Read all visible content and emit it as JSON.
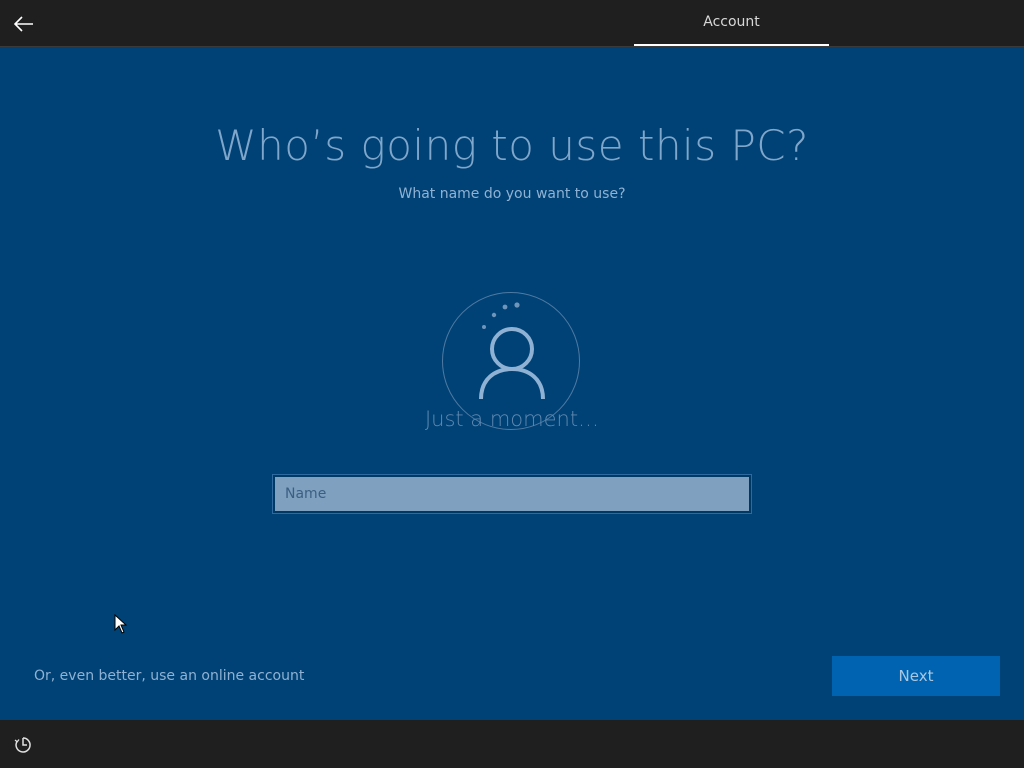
{
  "header": {
    "back_icon": "back-arrow-icon",
    "tab_label": "Account"
  },
  "main": {
    "title": "Who’s going to use this PC?",
    "subtitle": "What name do you want to use?",
    "avatar_icon": "user-avatar-icon",
    "loading_text": "Just a moment…",
    "name_input": {
      "placeholder": "Name",
      "value": ""
    },
    "online_account_link": "Or, even better, use an online account",
    "next_button": "Next"
  },
  "footer": {
    "accessibility_icon": "ease-of-access-icon"
  },
  "colors": {
    "background": "#004275",
    "topbar": "#1f1f1f",
    "accent_button": "#0063b1",
    "text_muted": "#8fb2d4"
  }
}
